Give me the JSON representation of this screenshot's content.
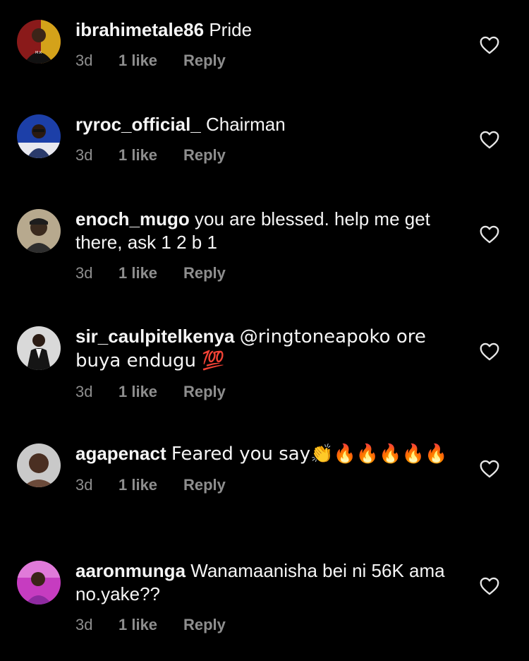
{
  "comments": [
    {
      "username": "ibrahimetale86",
      "text": "Pride",
      "time": "3d",
      "likes": "1 like",
      "reply": "Reply"
    },
    {
      "username": "ryroc_official_",
      "text": "Chairman",
      "time": "3d",
      "likes": "1 like",
      "reply": "Reply"
    },
    {
      "username": "enoch_mugo",
      "text": "you are blessed. help me get there, ask 1 2 b 1",
      "time": "3d",
      "likes": "1 like",
      "reply": "Reply"
    },
    {
      "username": "sir_caulpitelkenya",
      "text": "@ringtoneapoko ore buya endugu 💯",
      "time": "3d",
      "likes": "1 like",
      "reply": "Reply"
    },
    {
      "username": "agapenact",
      "text": "Feared you say👏🔥🔥🔥🔥🔥",
      "time": "3d",
      "likes": "1 like",
      "reply": "Reply"
    },
    {
      "username": "aaronmunga",
      "text": "Wanamaanisha bei ni 56K ama no.yake??",
      "time": "3d",
      "likes": "1 like",
      "reply": "Reply"
    }
  ],
  "icons": {
    "like": "heart-outline-icon"
  },
  "colors": {
    "background": "#000000",
    "text": "#f5f5f5",
    "meta": "#8e8e8e"
  }
}
